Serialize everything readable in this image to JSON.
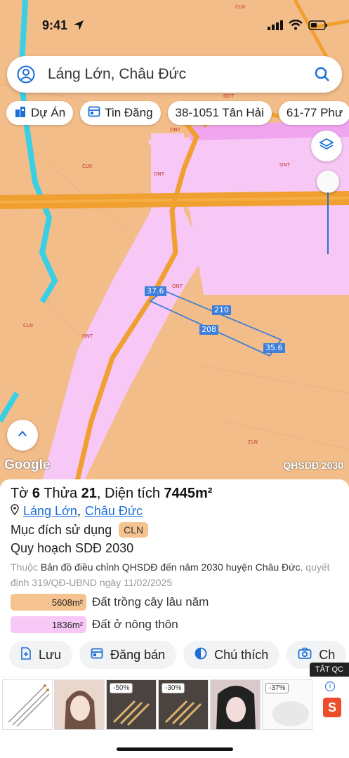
{
  "status_bar": {
    "time": "9:41"
  },
  "search": {
    "query": "Láng Lớn, Châu Đức"
  },
  "chips": [
    {
      "label": "Dự Án",
      "icon": "building-icon"
    },
    {
      "label": "Tin Đăng",
      "icon": "listing-icon"
    },
    {
      "label": "38-1051 Tân Hải",
      "icon": ""
    },
    {
      "label": "61-77 Phư",
      "icon": ""
    }
  ],
  "map": {
    "zone_labels": [
      "CLN",
      "ODT",
      "ONT",
      "CLN",
      "ONT",
      "ONT",
      "ONT",
      "CLN",
      "ONT",
      "CLN",
      "CLN"
    ],
    "dimensions": {
      "left": "37.6",
      "top": "210",
      "bottom": "208",
      "right": "35.6"
    },
    "attribution": "Google",
    "layer_name": "QHSDĐ 2030"
  },
  "panel": {
    "title_prefix": "Tờ",
    "sheet": "6",
    "parcel_label": "Thửa",
    "parcel": "21",
    "area_label": "Diện tích",
    "area": "7445m²",
    "location": {
      "commune": "Láng Lớn",
      "separator": ",",
      "district": "Châu Đức"
    },
    "purpose_label": "Mục đích sử dụng",
    "purpose_badge": "CLN",
    "plan_label": "Quy hoạch SDĐ 2030",
    "desc_prefix": "Thuộc",
    "desc_main": "Bản đồ điều chỉnh QHSDĐ đến năm 2030 huyện Châu Đức",
    "desc_suffix": ", quyết định 319/QĐ-UBND ngày 11/02/2025",
    "legend": [
      {
        "area": "5608m²",
        "label": "Đất trồng cây lâu năm",
        "color": "#f4c38f"
      },
      {
        "area": "1836m²",
        "label": "Đất ở nông thôn",
        "color": "#f7c8f5"
      }
    ],
    "actions": [
      {
        "label": "Lưu",
        "icon": "save-icon"
      },
      {
        "label": "Đăng bán",
        "icon": "post-icon"
      },
      {
        "label": "Chú thích",
        "icon": "legend-icon"
      },
      {
        "label": "Ch",
        "icon": "camera-icon"
      }
    ]
  },
  "ad": {
    "close_label": "TẮT QC",
    "discounts": [
      "-50%",
      "-30%",
      "-37%"
    ],
    "shop_glyph": "S",
    "info_glyph": "i"
  },
  "colors": {
    "accent": "#1c6fd6",
    "cln": "#f4c38f",
    "ont": "#f7c8f5",
    "road": "#f0a030",
    "measure": "#3d7fd9"
  }
}
